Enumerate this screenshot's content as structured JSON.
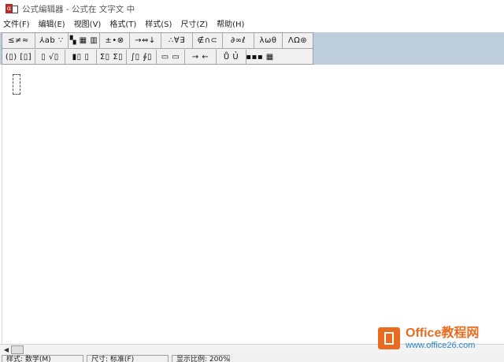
{
  "window": {
    "title": "公式编辑器 - 公式在 文字文 中",
    "icon": "equation-editor-app-icon"
  },
  "menu": [
    {
      "id": "file",
      "label": "文件(F)"
    },
    {
      "id": "edit",
      "label": "编辑(E)"
    },
    {
      "id": "view",
      "label": "视图(V)"
    },
    {
      "id": "format",
      "label": "格式(T)"
    },
    {
      "id": "style",
      "label": "样式(S)"
    },
    {
      "id": "size",
      "label": "尺寸(Z)"
    },
    {
      "id": "help",
      "label": "帮助(H)"
    }
  ],
  "palette_row1": [
    {
      "id": "relations",
      "glyph": "≤≠≈"
    },
    {
      "id": "spaces-ellipses",
      "glyph": "⅄ab ∵"
    },
    {
      "id": "embellishments",
      "glyph": "▚ ▦ ▥"
    },
    {
      "id": "operators",
      "glyph": "±•⊗"
    },
    {
      "id": "arrows",
      "glyph": "→⇔↓"
    },
    {
      "id": "logic",
      "glyph": "∴∀∃"
    },
    {
      "id": "set-theory",
      "glyph": "∉∩⊂"
    },
    {
      "id": "misc",
      "glyph": "∂∞ℓ"
    },
    {
      "id": "greek-lower",
      "glyph": "λωθ"
    },
    {
      "id": "greek-upper",
      "glyph": "ΛΩ⊛"
    }
  ],
  "palette_row2": [
    {
      "id": "fences",
      "glyph": "(▯) [▯]"
    },
    {
      "id": "fractions-radicals",
      "glyph": "▯ √▯"
    },
    {
      "id": "scripts",
      "glyph": "▮▯ ▯"
    },
    {
      "id": "summations",
      "glyph": "Σ▯ Σ▯"
    },
    {
      "id": "integrals",
      "glyph": "∫▯ ∮▯"
    },
    {
      "id": "bars",
      "glyph": "▭ ▭"
    },
    {
      "id": "labeled-arrows",
      "glyph": "→ ←"
    },
    {
      "id": "products",
      "glyph": "Ů Ủ"
    },
    {
      "id": "matrices",
      "glyph": "▪▪▪ ▦"
    }
  ],
  "statusbar": {
    "style": "样式: 数学(M)",
    "size": "尺寸: 标准(F)",
    "zoom": "显示比例: 200%"
  },
  "watermark": {
    "line1": "Office教程网",
    "line2": "www.office26.com"
  },
  "colors": {
    "toolbar_bg": "#bfcedc",
    "watermark_orange": "#e86b1f",
    "watermark_blue": "#2d87c9"
  }
}
